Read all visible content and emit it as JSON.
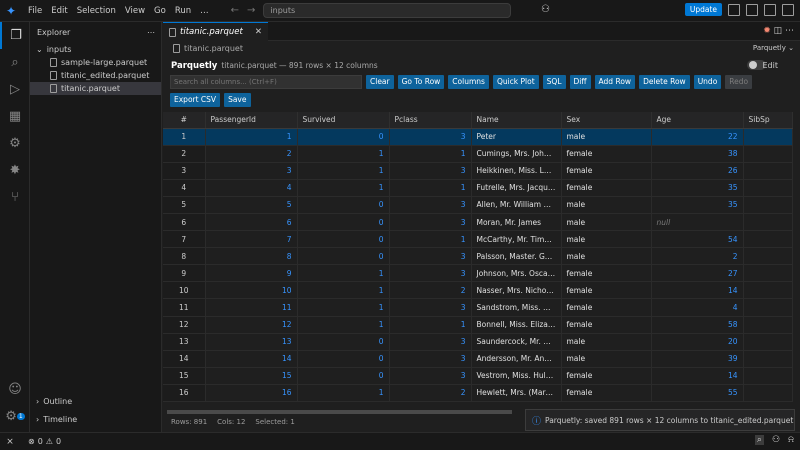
{
  "titlebar": {
    "menu": [
      "File",
      "Edit",
      "Selection",
      "View",
      "Go",
      "Run",
      "…"
    ],
    "search_text": "inputs",
    "update_label": "Update"
  },
  "explorer": {
    "title": "Explorer",
    "folder": "inputs",
    "files": [
      "sample-large.parquet",
      "titanic_edited.parquet",
      "titanic.parquet"
    ],
    "selected_file_index": 2,
    "outline_label": "Outline",
    "timeline_label": "Timeline",
    "accounts_badge": "1"
  },
  "editor": {
    "tab_label": "titanic.parquet",
    "breadcrumb": "titanic.parquet",
    "viewer_select": "Parquetly",
    "brand": "Parquetly",
    "file_info": "titanic.parquet — 891 rows × 12 columns",
    "edit_label": "Edit",
    "search_placeholder": "Search all columns... (Ctrl+F)",
    "buttons": [
      "Clear",
      "Go To Row",
      "Columns",
      "Quick Plot",
      "SQL",
      "Diff",
      "Add Row",
      "Delete Row",
      "Undo",
      "Redo"
    ],
    "buttons2": [
      "Export CSV",
      "Save"
    ],
    "columns": [
      "#",
      "PassengerId",
      "Survived",
      "Pclass",
      "Name",
      "Sex",
      "Age",
      "SibSp"
    ],
    "rows": [
      [
        "1",
        "1",
        "0",
        "3",
        "Peter",
        "male",
        "22",
        ""
      ],
      [
        "2",
        "2",
        "1",
        "1",
        "Cumings, Mrs. John Bra...",
        "female",
        "38",
        ""
      ],
      [
        "3",
        "3",
        "1",
        "3",
        "Heikkinen, Miss. Laina",
        "female",
        "26",
        ""
      ],
      [
        "4",
        "4",
        "1",
        "1",
        "Futrelle, Mrs. Jacques H...",
        "female",
        "35",
        ""
      ],
      [
        "5",
        "5",
        "0",
        "3",
        "Allen, Mr. William Henry",
        "male",
        "35",
        ""
      ],
      [
        "6",
        "6",
        "0",
        "3",
        "Moran, Mr. James",
        "male",
        "null",
        ""
      ],
      [
        "7",
        "7",
        "0",
        "1",
        "McCarthy, Mr. Timothy J",
        "male",
        "54",
        ""
      ],
      [
        "8",
        "8",
        "0",
        "3",
        "Palsson, Master. Gosta L...",
        "male",
        "2",
        ""
      ],
      [
        "9",
        "9",
        "1",
        "3",
        "Johnson, Mrs. Oscar W (...",
        "female",
        "27",
        ""
      ],
      [
        "10",
        "10",
        "1",
        "2",
        "Nasser, Mrs. Nicholas (A...",
        "female",
        "14",
        ""
      ],
      [
        "11",
        "11",
        "1",
        "3",
        "Sandstrom, Miss. Margu...",
        "female",
        "4",
        ""
      ],
      [
        "12",
        "12",
        "1",
        "1",
        "Bonnell, Miss. Elizabeth",
        "female",
        "58",
        ""
      ],
      [
        "13",
        "13",
        "0",
        "3",
        "Saundercock, Mr. Willia...",
        "male",
        "20",
        ""
      ],
      [
        "14",
        "14",
        "0",
        "3",
        "Andersson, Mr. Anders J...",
        "male",
        "39",
        ""
      ],
      [
        "15",
        "15",
        "0",
        "3",
        "Vestrom, Miss. Hulda A...",
        "female",
        "14",
        ""
      ],
      [
        "16",
        "16",
        "1",
        "2",
        "Hewlett, Mrs. (Mary D Ki...",
        "female",
        "55",
        ""
      ]
    ],
    "selected_row_index": 0,
    "status": {
      "rows": "Rows: 891",
      "cols": "Cols: 12",
      "selected": "Selected: 1"
    }
  },
  "toast": {
    "message": "Parquetly: saved 891 rows × 12 columns to titanic_edited.parquet (0.03..."
  },
  "statusbar": {
    "errors": "0",
    "warnings": "0"
  },
  "colors": {
    "accent": "#0078d4",
    "button": "#0e639c",
    "number": "#3794ff",
    "selected_row": "#04395e"
  }
}
